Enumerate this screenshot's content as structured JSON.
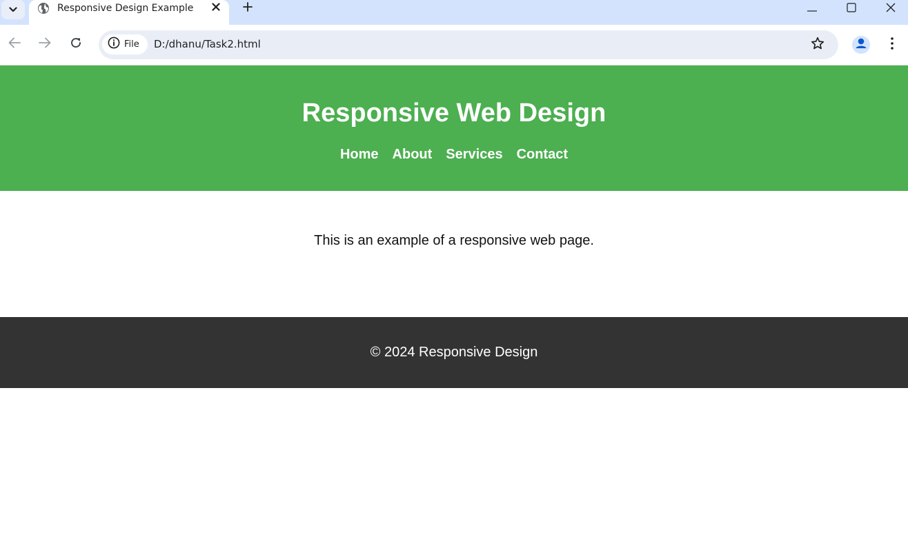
{
  "browser": {
    "tab": {
      "title": "Responsive Design Example"
    },
    "address_bar": {
      "site_chip_label": "File",
      "url": "D:/dhanu/Task2.html"
    },
    "icons": {
      "tab_search": "chevron-down-icon",
      "favicon": "globe-icon",
      "tab_close": "close-icon",
      "new_tab": "plus-icon",
      "back": "arrow-left-icon",
      "forward": "arrow-right-icon",
      "reload": "reload-icon",
      "site_info": "info-icon",
      "bookmark": "star-icon",
      "profile": "person-icon",
      "menu": "kebab-menu-icon",
      "minimize": "minimize-icon",
      "maximize": "maximize-icon",
      "window_close": "close-icon"
    }
  },
  "page": {
    "header": {
      "title": "Responsive Web Design",
      "background_color": "#4caf50",
      "nav": [
        {
          "label": "Home"
        },
        {
          "label": "About"
        },
        {
          "label": "Services"
        },
        {
          "label": "Contact"
        }
      ]
    },
    "main": {
      "text": "This is an example of a responsive web page."
    },
    "footer": {
      "text": "© 2024 Responsive Design",
      "background_color": "#333333"
    }
  }
}
